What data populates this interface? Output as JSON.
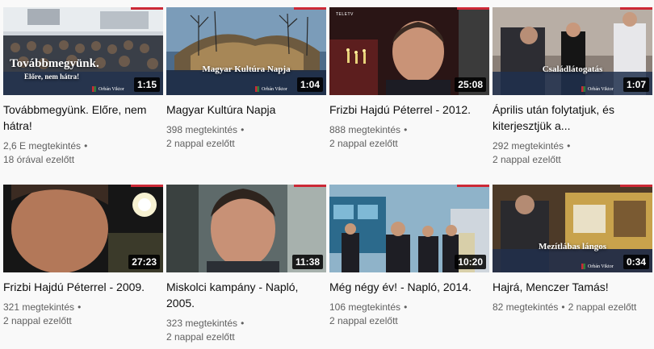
{
  "videos": [
    {
      "title": "Továbbmegyünk. Előre, nem hátra!",
      "views": "2,6 E megtekintés",
      "age": "18 órával ezelőtt",
      "duration": "1:15",
      "thumb_caption": "Továbbmegyünk.",
      "thumb_caption2": "Előre, nem hátra!",
      "thumb_logo": "Orbán Viktor"
    },
    {
      "title": "Magyar Kultúra Napja",
      "views": "398 megtekintés",
      "age": "2 nappal ezelőtt",
      "duration": "1:04",
      "thumb_caption": "Magyar Kultúra Napja",
      "thumb_logo": "Orbán Viktor"
    },
    {
      "title": "Frizbi Hajdú Péterrel - 2012.",
      "views": "888 megtekintés",
      "age": "2 nappal ezelőtt",
      "duration": "25:08",
      "thumb_tag": "TELETV"
    },
    {
      "title": "Április után folytatjuk, és kiterjesztjük a...",
      "views": "292 megtekintés",
      "age": "2 nappal ezelőtt",
      "duration": "1:07",
      "thumb_caption": "Családlátogatás",
      "thumb_logo": "Orbán Viktor"
    },
    {
      "title": "Frizbi Hajdú Péterrel - 2009.",
      "views": "321 megtekintés",
      "age": "2 nappal ezelőtt",
      "duration": "27:23"
    },
    {
      "title": "Miskolci kampány - Napló, 2005.",
      "views": "323 megtekintés",
      "age": "2 nappal ezelőtt",
      "duration": "11:38"
    },
    {
      "title": "Még négy év! - Napló, 2014.",
      "views": "106 megtekintés",
      "age": "2 nappal ezelőtt",
      "duration": "10:20"
    },
    {
      "title": "Hajrá, Menczer Tamás!",
      "views": "82 megtekintés",
      "age": "2 nappal ezelőtt",
      "duration": "0:34",
      "thumb_caption": "Mezítlábas lángos",
      "thumb_logo": "Orbán Viktor"
    }
  ],
  "colors": {
    "accent": "#cc2936",
    "title_text": "#0f0f0f",
    "meta_text": "#606060",
    "background": "#f9f9f9"
  }
}
